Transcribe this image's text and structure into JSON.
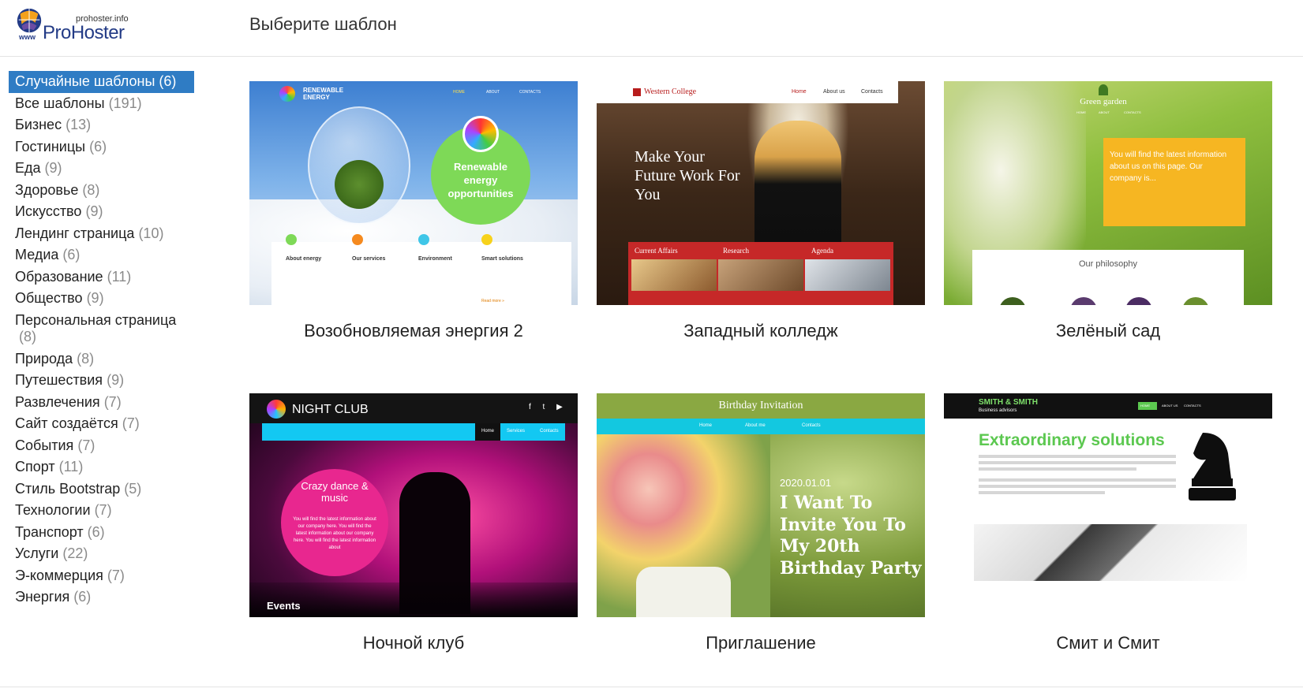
{
  "header": {
    "logo_small": "prohoster.info",
    "logo_www": "www",
    "logo_text": "ProHoster",
    "title": "Выберите шаблон"
  },
  "sidebar": {
    "items": [
      {
        "label": "Случайные шаблоны",
        "count": "(6)",
        "active": true
      },
      {
        "label": "Все шаблоны",
        "count": "(191)"
      },
      {
        "label": "Бизнес",
        "count": "(13)"
      },
      {
        "label": "Гостиницы",
        "count": "(6)"
      },
      {
        "label": "Еда",
        "count": "(9)"
      },
      {
        "label": "Здоровье",
        "count": "(8)"
      },
      {
        "label": "Искусство",
        "count": "(9)"
      },
      {
        "label": "Лендинг страница",
        "count": "(10)"
      },
      {
        "label": "Медиа",
        "count": "(6)"
      },
      {
        "label": "Образование",
        "count": "(11)"
      },
      {
        "label": "Общество",
        "count": "(9)"
      },
      {
        "label": "Персональная страница",
        "count": "(8)"
      },
      {
        "label": "Природа",
        "count": "(8)"
      },
      {
        "label": "Путешествия",
        "count": "(9)"
      },
      {
        "label": "Развлечения",
        "count": "(7)"
      },
      {
        "label": "Сайт создаётся",
        "count": "(7)"
      },
      {
        "label": "События",
        "count": "(7)"
      },
      {
        "label": "Спорт",
        "count": "(11)"
      },
      {
        "label": "Стиль Bootstrap",
        "count": "(5)"
      },
      {
        "label": "Технологии",
        "count": "(7)"
      },
      {
        "label": "Транспорт",
        "count": "(6)"
      },
      {
        "label": "Услуги",
        "count": "(22)"
      },
      {
        "label": "Э-коммерция",
        "count": "(7)"
      },
      {
        "label": "Энергия",
        "count": "(6)"
      }
    ]
  },
  "templates": [
    {
      "title": "Возобновляемая энергия 2",
      "thumb": {
        "brand": "RENEWABLE ENERGY",
        "nav": [
          "HOME",
          "ABOUT",
          "CONTACTS"
        ],
        "bubble": "Renewable energy opportunities",
        "features": [
          "About energy",
          "Our services",
          "Environment",
          "Smart solutions"
        ],
        "more": "Read more »"
      }
    },
    {
      "title": "Западный колледж",
      "thumb": {
        "brand": "Western College",
        "nav": [
          "Home",
          "About us",
          "Contacts"
        ],
        "headline": "Make Your Future Work For You",
        "tabs": [
          "Current Affairs",
          "Research",
          "Agenda"
        ]
      }
    },
    {
      "title": "Зелёный сад",
      "thumb": {
        "brand": "Green garden",
        "nav": [
          "HOME",
          "ABOUT",
          "CONTACTS"
        ],
        "box_text": "You will find the latest information about us on this page. Our company is...",
        "section": "Our philosophy"
      }
    },
    {
      "title": "Ночной клуб",
      "thumb": {
        "brand": "NIGHT CLUB",
        "nav": [
          "Home",
          "Services",
          "Contacts"
        ],
        "circle_title": "Crazy dance & music",
        "circle_text": "You will find the latest information about our company here. You will find the latest information about our company here. You will find the latest information about",
        "footer": "Events"
      }
    },
    {
      "title": "Приглашение",
      "thumb": {
        "brand": "Birthday Invitation",
        "nav": [
          "Home",
          "About me",
          "Contacts"
        ],
        "date": "2020.01.01",
        "headline": "I Want To Invite You To My 20th Birthday Party"
      }
    },
    {
      "title": "Смит и Смит",
      "thumb": {
        "brand": "SMITH & SMITH",
        "sub": "Business advisors",
        "nav": [
          "HOME",
          "ABOUT US",
          "CONTACTS"
        ],
        "headline": "Extraordinary solutions"
      }
    }
  ]
}
